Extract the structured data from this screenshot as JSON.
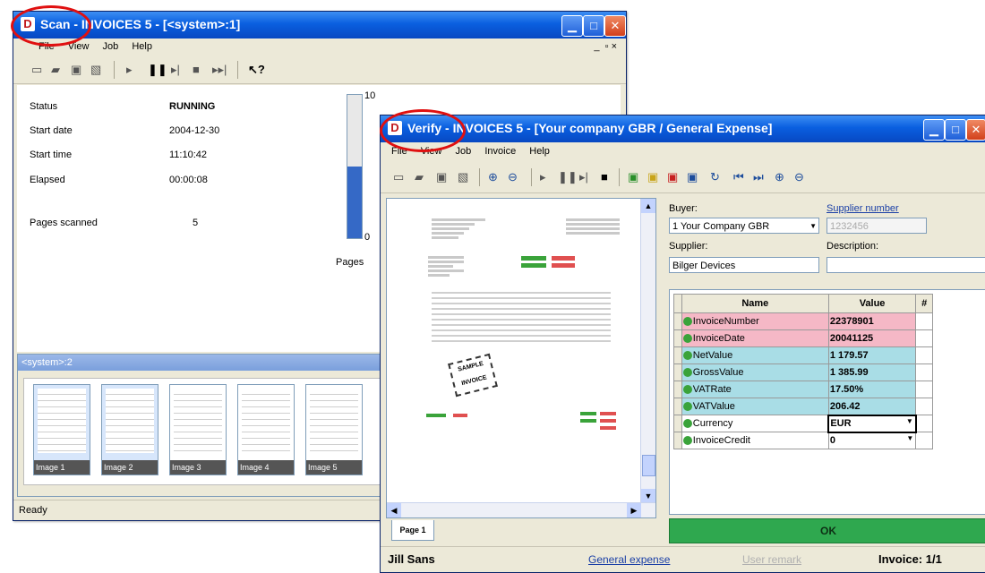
{
  "scan_window": {
    "title": "Scan - INVOICES 5 - [<system>:1]",
    "menu": [
      "File",
      "View",
      "Job",
      "Help"
    ],
    "mdi_controls": "_ æ x",
    "status": [
      {
        "label": "Status",
        "value": "RUNNING"
      },
      {
        "label": "Start date",
        "value": "2004-12-30"
      },
      {
        "label": "Start time",
        "value": "11:10:42"
      },
      {
        "label": "Elapsed",
        "value": "00:00:08"
      }
    ],
    "pages_scanned_label": "Pages scanned",
    "pages_scanned_value": "5",
    "gauge": {
      "max_label": "10",
      "min_label": "0",
      "caption": "Pages",
      "value": 5,
      "max": 10
    },
    "thumb_panel_title": "<system>:2",
    "thumbnails": [
      "Image 1",
      "Image 2",
      "Image 3",
      "Image 4",
      "Image 5"
    ],
    "statusbar": "Ready"
  },
  "verify_window": {
    "title": "Verify - INVOICES 5 - [Your company GBR / General Expense]",
    "menu": [
      "File",
      "View",
      "Job",
      "Invoice",
      "Help"
    ],
    "page_tab": "Page 1",
    "sample_stamp": "SAMPLE INVOICE",
    "buyer_label": "Buyer:",
    "buyer_value": "1  Your Company GBR",
    "supplier_number_label": "Supplier number",
    "supplier_number_value": "1232456",
    "supplier_label": "Supplier:",
    "supplier_value": "Bilger Devices",
    "description_label": "Description:",
    "description_value": "",
    "table_headers": {
      "name": "Name",
      "value": "Value",
      "flag": "#"
    },
    "fields": [
      {
        "name": "InvoiceNumber",
        "value": "22378901",
        "color": "#f5b8c6"
      },
      {
        "name": "InvoiceDate",
        "value": "20041125",
        "color": "#f5b8c6"
      },
      {
        "name": "NetValue",
        "value": "1 179.57",
        "color": "#a9dde6"
      },
      {
        "name": "GrossValue",
        "value": "1 385.99",
        "color": "#a9dde6"
      },
      {
        "name": "VATRate",
        "value": "17.50%",
        "color": "#a9dde6"
      },
      {
        "name": "VATValue",
        "value": "206.42",
        "color": "#a9dde6"
      },
      {
        "name": "Currency",
        "value": "EUR",
        "color": "#ffffff"
      },
      {
        "name": "InvoiceCredit",
        "value": "0",
        "color": "#ffffff"
      }
    ],
    "ok_label": "OK",
    "status_user": "Jill Sans",
    "status_category": "General expense",
    "status_remark": "User remark",
    "status_invoice": "Invoice: 1/1"
  },
  "colors": {
    "ok_green": "#2fa84f",
    "title_blue": "#0a5fe0",
    "highlight_red": "#e01010",
    "gauge_blue": "#3569c6"
  }
}
